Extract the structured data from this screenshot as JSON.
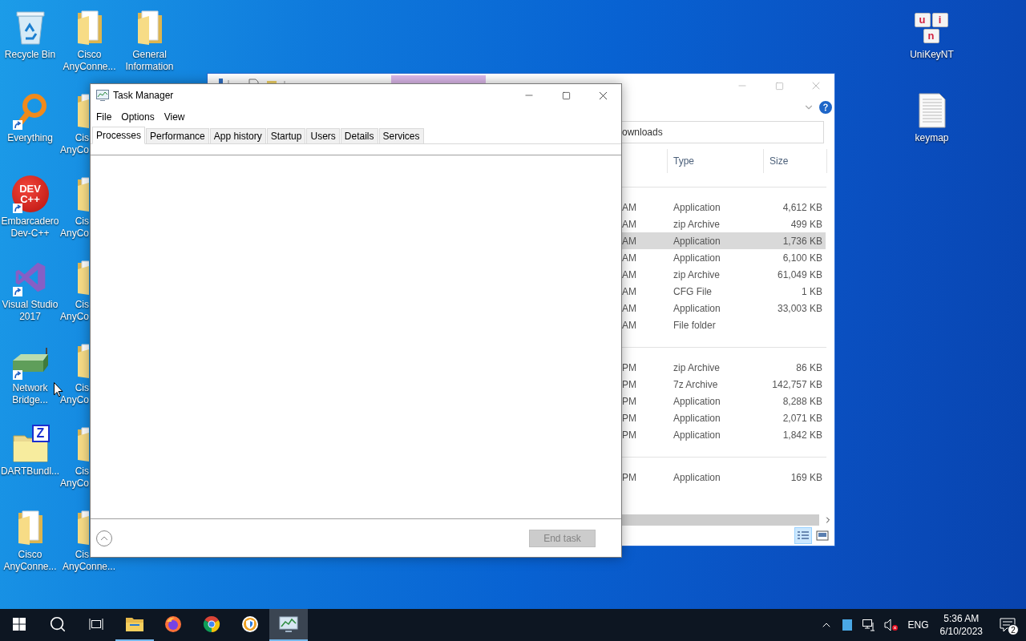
{
  "desktop": {
    "columns": [
      [
        {
          "kind": "recycle-bin",
          "label": "Recycle Bin",
          "shortcut": false
        },
        {
          "kind": "magnifier",
          "label": "Everything",
          "shortcut": true
        },
        {
          "kind": "dev-logo",
          "label": "Embarcadero Dev-C++",
          "logo_text": "DEV C++",
          "shortcut": true
        },
        {
          "kind": "ribbon-logo",
          "label": "Visual Studio 2017",
          "shortcut": true
        },
        {
          "kind": "router",
          "label": "Network Bridge...",
          "shortcut": true
        },
        {
          "kind": "archive-folder",
          "label": "DARTBundl...",
          "logo_text": "Z",
          "shortcut": false
        },
        {
          "kind": "folder",
          "label": "Cisco AnyConne...",
          "shortcut": false
        }
      ],
      [
        {
          "kind": "folder",
          "label": "Cisco AnyConne...",
          "shortcut": false
        },
        {
          "kind": "covered-folder",
          "lines": [
            "Cis",
            "AnyCo"
          ]
        },
        {
          "kind": "covered-folder",
          "lines": [
            "Cis",
            "AnyCo"
          ]
        },
        {
          "kind": "covered-folder",
          "lines": [
            "Cis",
            "AnyCo"
          ]
        },
        {
          "kind": "covered-folder",
          "lines": [
            "Cis",
            "AnyCo"
          ]
        },
        {
          "kind": "covered-folder",
          "lines": [
            "Cis",
            "AnyCo"
          ]
        },
        {
          "kind": "covered-folder",
          "lines": [
            "Cis",
            "AnyConne..."
          ]
        }
      ],
      [
        {
          "kind": "folder",
          "label": "General Information",
          "shortcut": false
        }
      ]
    ],
    "right_column": [
      {
        "kind": "keys",
        "label": "UniKeyNT",
        "key_letters": [
          "u",
          "i",
          "n"
        ],
        "shortcut": false
      },
      {
        "kind": "text-file",
        "label": "keymap",
        "shortcut": false
      }
    ]
  },
  "explorer": {
    "address_text": "ownloads",
    "headers": [
      "Type",
      "Size"
    ],
    "groups": [
      {
        "rows": [
          {
            "column_1": "AM",
            "type": "Application",
            "size": "4,612 KB",
            "selected": false
          },
          {
            "column_1": "AM",
            "type": "zip Archive",
            "size": "499 KB",
            "selected": false
          },
          {
            "column_1": "AM",
            "type": "Application",
            "size": "1,736 KB",
            "selected": true
          },
          {
            "column_1": "AM",
            "type": "Application",
            "size": "6,100 KB",
            "selected": false
          },
          {
            "column_1": "AM",
            "type": "zip Archive",
            "size": "61,049 KB",
            "selected": false
          },
          {
            "column_1": "AM",
            "type": "CFG File",
            "size": "1 KB",
            "selected": false
          },
          {
            "column_1": "AM",
            "type": "Application",
            "size": "33,003 KB",
            "selected": false
          },
          {
            "column_1": "AM",
            "type": "File folder",
            "selected": false
          }
        ]
      },
      {
        "rows": [
          {
            "column_1": "PM",
            "type": "zip Archive",
            "size": "86 KB",
            "selected": false
          },
          {
            "column_1": "PM",
            "type": "7z Archive",
            "size": "142,757 KB",
            "selected": false
          },
          {
            "column_1": "PM",
            "type": "Application",
            "size": "8,288 KB",
            "selected": false
          },
          {
            "column_1": "PM",
            "type": "Application",
            "size": "2,071 KB",
            "selected": false
          },
          {
            "column_1": "PM",
            "type": "Application",
            "size": "1,842 KB",
            "selected": false
          }
        ]
      },
      {
        "rows": [
          {
            "column_1": "PM",
            "type": "Application",
            "size": "169 KB",
            "selected": false
          }
        ]
      }
    ],
    "view_buttons": [
      {
        "kind": "details",
        "selected": true
      },
      {
        "kind": "large-icons",
        "selected": false
      }
    ]
  },
  "task_manager": {
    "title": "Task Manager",
    "menu": [
      "File",
      "Options",
      "View"
    ],
    "tabs": [
      {
        "label": "Processes",
        "selected": true
      },
      {
        "label": "Performance",
        "selected": false
      },
      {
        "label": "App history",
        "selected": false
      },
      {
        "label": "Startup",
        "selected": false
      },
      {
        "label": "Users",
        "selected": false
      },
      {
        "label": "Details",
        "selected": false
      },
      {
        "label": "Services",
        "selected": false
      }
    ],
    "end_task": {
      "label": "End task",
      "disabled": true
    }
  },
  "taskbar": {
    "items": [
      {
        "kind": "start",
        "running": false,
        "active": false
      },
      {
        "kind": "search",
        "running": false,
        "active": false
      },
      {
        "kind": "task-view",
        "running": false,
        "active": false
      },
      {
        "kind": "explorer",
        "running": true,
        "active": false
      },
      {
        "kind": "firefox",
        "running": false,
        "active": false
      },
      {
        "kind": "chrome",
        "running": false,
        "active": false
      },
      {
        "kind": "shield-browser",
        "running": false,
        "active": false
      },
      {
        "kind": "task-manager",
        "running": true,
        "active": true
      }
    ],
    "tray": {
      "language": "ENG",
      "time": "5:36 AM",
      "date": "6/10/2023",
      "notifications": "2"
    }
  }
}
